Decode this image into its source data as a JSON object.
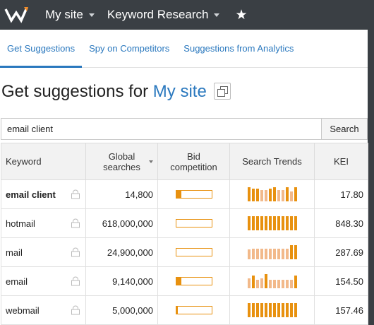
{
  "header": {
    "site_menu": "My site",
    "tool_menu": "Keyword Research"
  },
  "tabs": [
    {
      "label": "Get Suggestions",
      "active": true
    },
    {
      "label": "Spy on Competitors",
      "active": false
    },
    {
      "label": "Suggestions from Analytics",
      "active": false
    }
  ],
  "page": {
    "title_prefix": "Get suggestions for",
    "title_site": "My site"
  },
  "search": {
    "value": "email client",
    "button_label": "Search"
  },
  "table": {
    "columns": {
      "keyword": "Keyword",
      "global_searches_line1": "Global",
      "global_searches_line2": "searches",
      "bid_line1": "Bid",
      "bid_line2": "competition",
      "trends": "Search Trends",
      "kei": "KEI"
    },
    "rows": [
      {
        "keyword": "email client",
        "bold": true,
        "searches": "14,800",
        "bid": 0.15,
        "trends": [
          1,
          0.9,
          0.9,
          0.8,
          0.8,
          0.9,
          1,
          0.8,
          0.8,
          1,
          0.7,
          1
        ],
        "kei": "17.80"
      },
      {
        "keyword": "hotmail",
        "bold": false,
        "searches": "618,000,000",
        "bid": 0.0,
        "trends": [
          1,
          1,
          1,
          1,
          1,
          1,
          1,
          1,
          1,
          1,
          1,
          1
        ],
        "kei": "848.30"
      },
      {
        "keyword": "mail",
        "bold": false,
        "searches": "24,900,000",
        "bid": 0.0,
        "trends": [
          0.7,
          0.75,
          0.75,
          0.75,
          0.75,
          0.75,
          0.75,
          0.75,
          0.75,
          0.75,
          1,
          1
        ],
        "kei": "287.69"
      },
      {
        "keyword": "email",
        "bold": false,
        "searches": "9,140,000",
        "bid": 0.15,
        "trends": [
          0.7,
          0.9,
          0.6,
          0.7,
          1,
          0.6,
          0.6,
          0.6,
          0.6,
          0.6,
          0.6,
          0.9
        ],
        "kei": "154.50"
      },
      {
        "keyword": "webmail",
        "bold": false,
        "searches": "5,000,000",
        "bid": 0.05,
        "trends": [
          1,
          1,
          1,
          1,
          1,
          1,
          1,
          1,
          1,
          1,
          1,
          1
        ],
        "kei": "157.46"
      }
    ]
  },
  "colors": {
    "accent": "#2a78be",
    "bar_orange": "#e8910f",
    "bar_light": "#f2b98a",
    "topbar": "#3a3f44"
  }
}
